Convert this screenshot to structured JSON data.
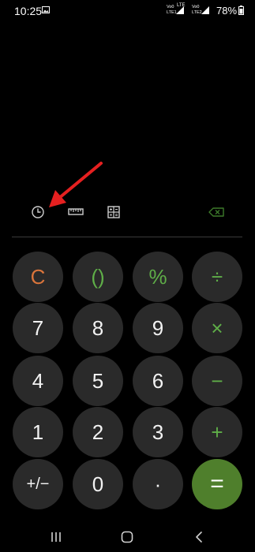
{
  "status_bar": {
    "time": "10:25",
    "sim1_line1": "Vo0",
    "sim1_line2": "LTE1",
    "sim1_net": "LTE",
    "sim2_line1": "Vo0",
    "sim2_line2": "LTE2",
    "battery": "78%"
  },
  "toolbar": {
    "icons": [
      "history-icon",
      "ruler-icon",
      "scientific-icon",
      "backspace-icon"
    ]
  },
  "keypad": {
    "clear": "C",
    "parentheses": "()",
    "percent": "%",
    "divide": "÷",
    "seven": "7",
    "eight": "8",
    "nine": "9",
    "multiply": "×",
    "four": "4",
    "five": "5",
    "six": "6",
    "minus": "−",
    "one": "1",
    "two": "2",
    "three": "3",
    "plus": "+",
    "sign": "+/−",
    "zero": "0",
    "decimal": "·",
    "equals": "="
  },
  "colors": {
    "background": "#000000",
    "key": "#2a2a2a",
    "operator": "#5fae48",
    "clear": "#d9743b",
    "equals": "#4f7f2c",
    "annotation_arrow": "#e52020"
  },
  "navigation": {
    "icons": [
      "recent-apps-icon",
      "home-icon",
      "back-icon"
    ]
  }
}
